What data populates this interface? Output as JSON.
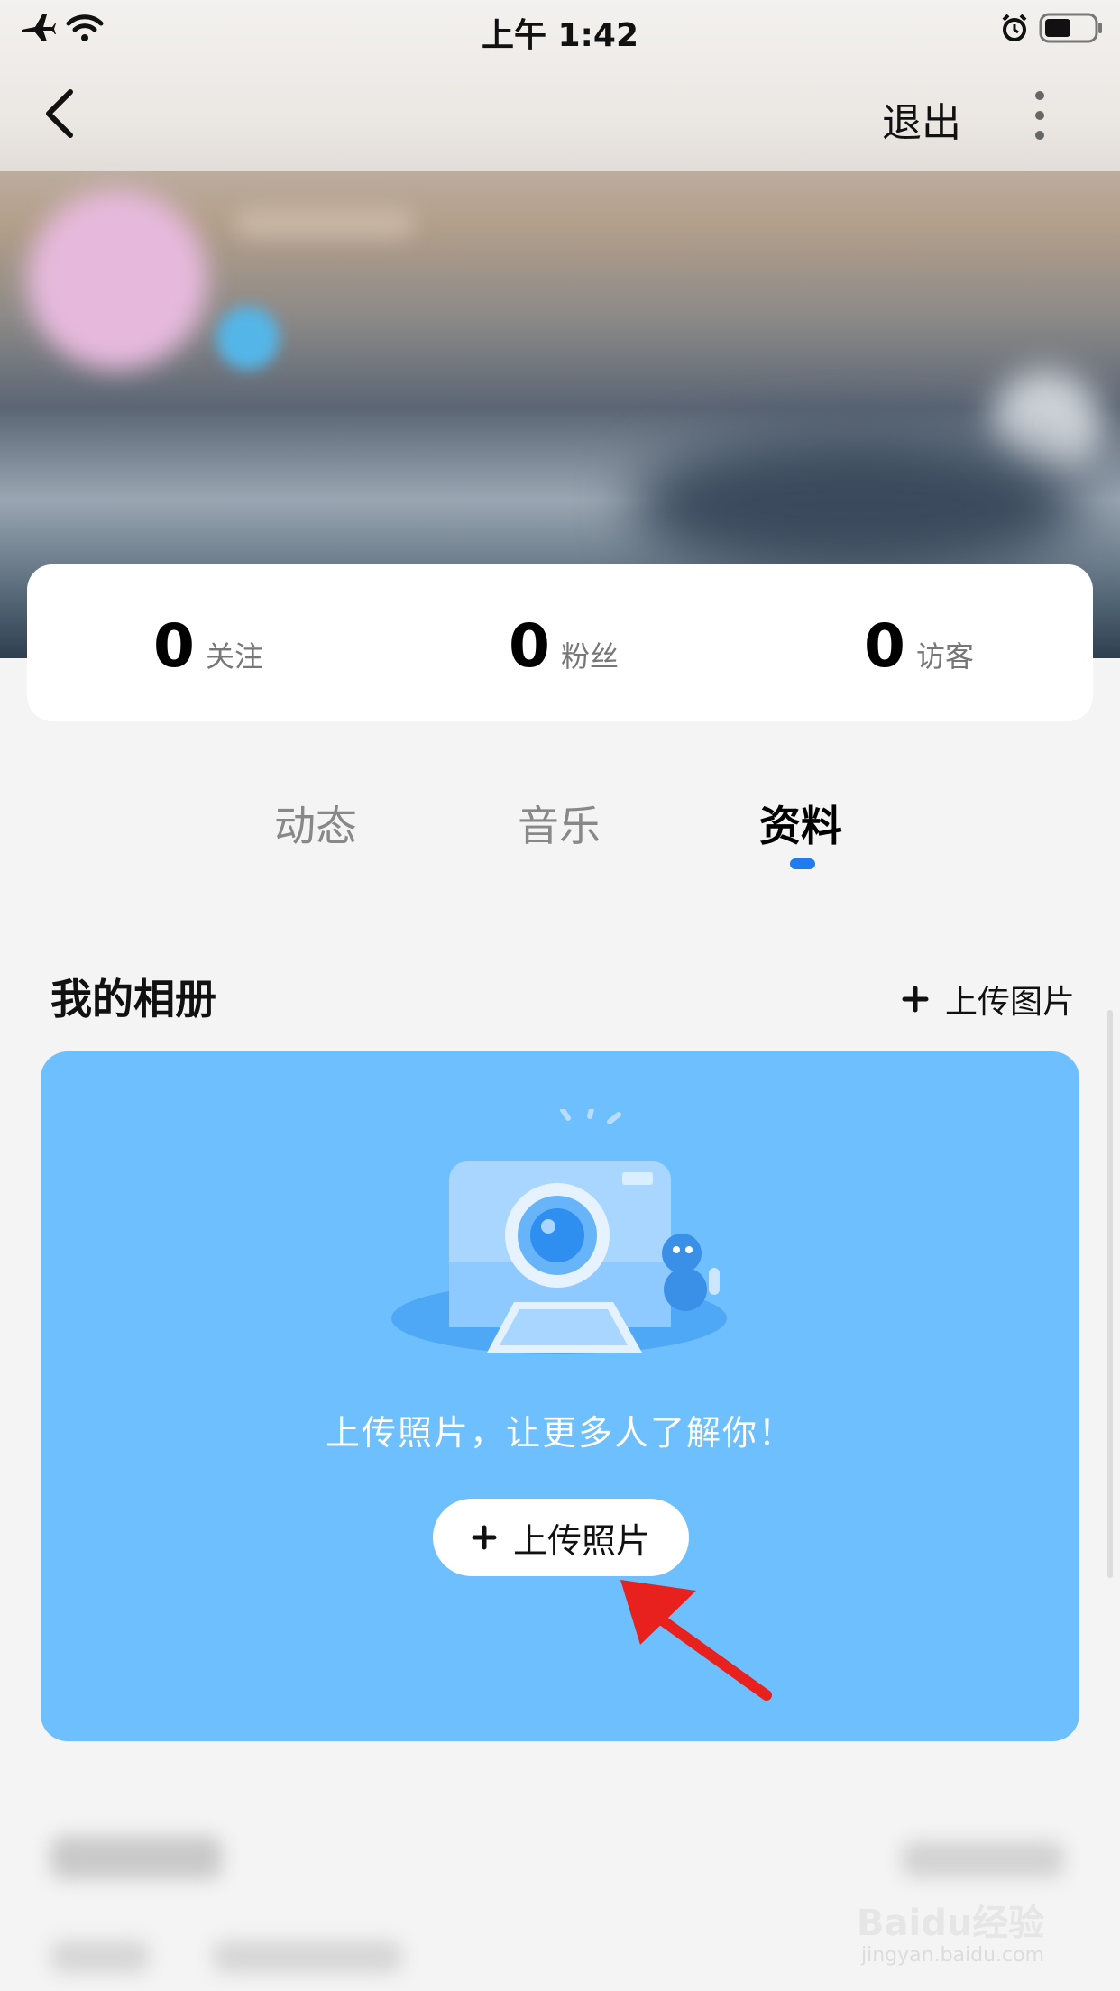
{
  "status_bar": {
    "time": "上午 1:42"
  },
  "nav": {
    "exit_label": "退出"
  },
  "stats": [
    {
      "value": "0",
      "label": "关注"
    },
    {
      "value": "0",
      "label": "粉丝"
    },
    {
      "value": "0",
      "label": "访客"
    }
  ],
  "tabs": [
    {
      "label": "动态",
      "active": false
    },
    {
      "label": "音乐",
      "active": false
    },
    {
      "label": "资料",
      "active": true
    }
  ],
  "album": {
    "title": "我的相册",
    "upload_link": "上传图片",
    "message": "上传照片，让更多人了解你！",
    "upload_button": "上传照片"
  },
  "watermark": {
    "main": "Baidu经验",
    "sub": "jingyan.baidu.com"
  },
  "colors": {
    "accent": "#1e7cf0",
    "album_bg": "#6ebffd",
    "arrow": "#e8201e"
  }
}
